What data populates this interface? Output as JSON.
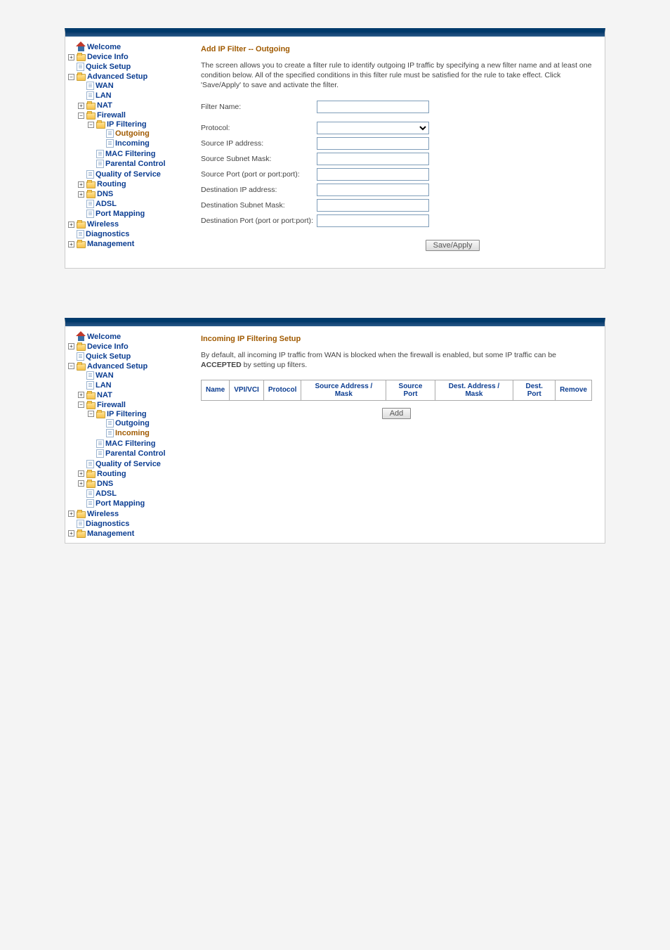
{
  "screenshot1": {
    "nav": {
      "welcome": "Welcome",
      "device_info": "Device Info",
      "quick_setup": "Quick Setup",
      "advanced_setup": "Advanced Setup",
      "wan": "WAN",
      "lan": "LAN",
      "nat": "NAT",
      "firewall": "Firewall",
      "ip_filtering": "IP Filtering",
      "outgoing": "Outgoing",
      "incoming": "Incoming",
      "mac_filtering": "MAC Filtering",
      "parental_control": "Parental Control",
      "qos": "Quality of Service",
      "routing": "Routing",
      "dns": "DNS",
      "adsl": "ADSL",
      "port_mapping": "Port Mapping",
      "wireless": "Wireless",
      "diagnostics": "Diagnostics",
      "management": "Management"
    },
    "content": {
      "title": "Add IP Filter -- Outgoing",
      "desc": "The screen allows you to create a filter rule to identify outgoing IP traffic by specifying a new filter name and at least one condition below. All of the specified conditions in this filter rule must be satisfied for the rule to take effect. Click 'Save/Apply' to save and activate the filter.",
      "fields": {
        "filter_name": "Filter Name:",
        "protocol": "Protocol:",
        "src_ip": "Source IP address:",
        "src_mask": "Source Subnet Mask:",
        "src_port": "Source Port (port or port:port):",
        "dst_ip": "Destination IP address:",
        "dst_mask": "Destination Subnet Mask:",
        "dst_port": "Destination Port (port or port:port):"
      },
      "save_btn": "Save/Apply"
    }
  },
  "screenshot2": {
    "nav": {
      "welcome": "Welcome",
      "device_info": "Device Info",
      "quick_setup": "Quick Setup",
      "advanced_setup": "Advanced Setup",
      "wan": "WAN",
      "lan": "LAN",
      "nat": "NAT",
      "firewall": "Firewall",
      "ip_filtering": "IP Filtering",
      "outgoing": "Outgoing",
      "incoming": "Incoming",
      "mac_filtering": "MAC Filtering",
      "parental_control": "Parental Control",
      "qos": "Quality of Service",
      "routing": "Routing",
      "dns": "DNS",
      "adsl": "ADSL",
      "port_mapping": "Port Mapping",
      "wireless": "Wireless",
      "diagnostics": "Diagnostics",
      "management": "Management"
    },
    "content": {
      "title": "Incoming IP Filtering Setup",
      "desc_pre": "By default, all incoming IP traffic from WAN is blocked when the firewall is enabled, but some IP traffic can be ",
      "desc_bold": "ACCEPTED",
      "desc_post": " by setting up filters.",
      "columns": [
        "Name",
        "VPI/VCI",
        "Protocol",
        "Source Address / Mask",
        "Source Port",
        "Dest. Address / Mask",
        "Dest. Port",
        "Remove"
      ],
      "add_btn": "Add"
    }
  }
}
